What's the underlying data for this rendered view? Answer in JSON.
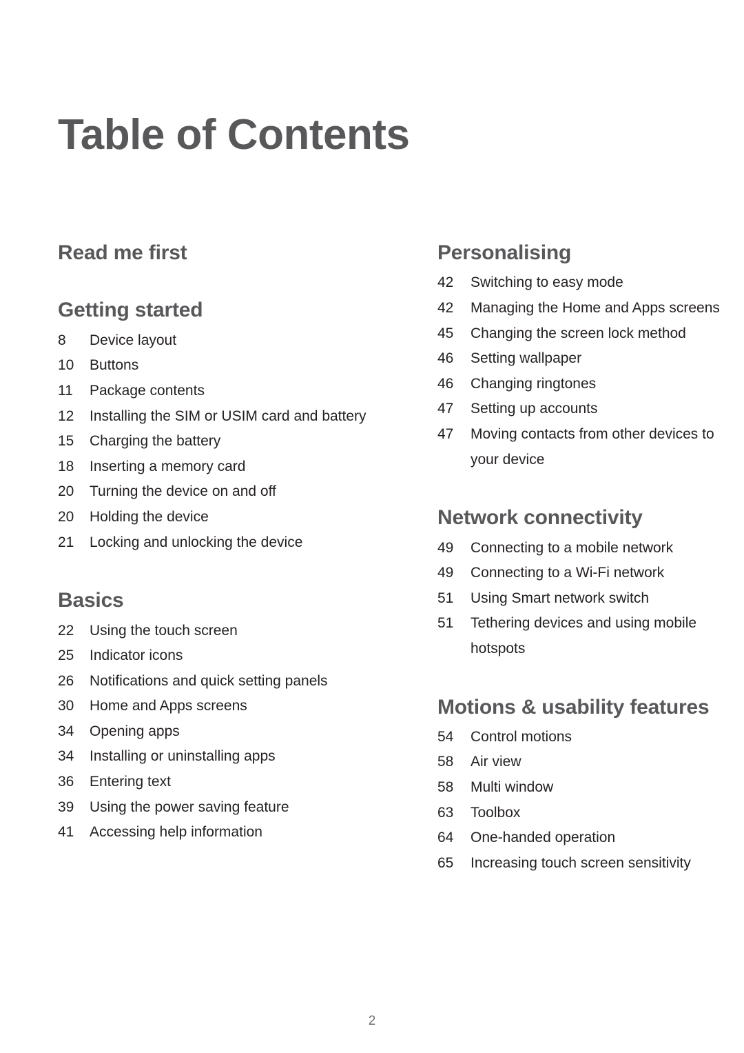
{
  "document": {
    "title": "Table of Contents",
    "folio": "2"
  },
  "columns": {
    "left": [
      {
        "heading": "Read me first",
        "entries": []
      },
      {
        "heading": "Getting started",
        "entries": [
          {
            "page": "8",
            "title": "Device layout"
          },
          {
            "page": "10",
            "title": "Buttons"
          },
          {
            "page": "11",
            "title": "Package contents"
          },
          {
            "page": "12",
            "title": "Installing the SIM or USIM card and battery"
          },
          {
            "page": "15",
            "title": "Charging the battery"
          },
          {
            "page": "18",
            "title": "Inserting a memory card"
          },
          {
            "page": "20",
            "title": "Turning the device on and off"
          },
          {
            "page": "20",
            "title": "Holding the device"
          },
          {
            "page": "21",
            "title": "Locking and unlocking the device"
          }
        ]
      },
      {
        "heading": "Basics",
        "entries": [
          {
            "page": "22",
            "title": "Using the touch screen"
          },
          {
            "page": "25",
            "title": "Indicator icons"
          },
          {
            "page": "26",
            "title": "Notifications and quick setting panels"
          },
          {
            "page": "30",
            "title": "Home and Apps screens"
          },
          {
            "page": "34",
            "title": "Opening apps"
          },
          {
            "page": "34",
            "title": "Installing or uninstalling apps"
          },
          {
            "page": "36",
            "title": "Entering text"
          },
          {
            "page": "39",
            "title": "Using the power saving feature"
          },
          {
            "page": "41",
            "title": "Accessing help information"
          }
        ]
      }
    ],
    "right": [
      {
        "heading": "Personalising",
        "entries": [
          {
            "page": "42",
            "title": "Switching to easy mode"
          },
          {
            "page": "42",
            "title": "Managing the Home and Apps screens"
          },
          {
            "page": "45",
            "title": "Changing the screen lock method"
          },
          {
            "page": "46",
            "title": "Setting wallpaper"
          },
          {
            "page": "46",
            "title": "Changing ringtones"
          },
          {
            "page": "47",
            "title": "Setting up accounts"
          },
          {
            "page": "47",
            "title": "Moving contacts from other devices to your device"
          }
        ]
      },
      {
        "heading": "Network connectivity",
        "entries": [
          {
            "page": "49",
            "title": "Connecting to a mobile network"
          },
          {
            "page": "49",
            "title": "Connecting to a Wi-Fi network"
          },
          {
            "page": "51",
            "title": "Using Smart network switch"
          },
          {
            "page": "51",
            "title": "Tethering devices and using mobile hotspots"
          }
        ]
      },
      {
        "heading": "Motions & usability features",
        "entries": [
          {
            "page": "54",
            "title": "Control motions"
          },
          {
            "page": "58",
            "title": "Air view"
          },
          {
            "page": "58",
            "title": "Multi window"
          },
          {
            "page": "63",
            "title": "Toolbox"
          },
          {
            "page": "64",
            "title": "One-handed operation"
          },
          {
            "page": "65",
            "title": "Increasing touch screen sensitivity"
          }
        ]
      }
    ]
  },
  "colors": {
    "heading": "#58585B",
    "body": "#231F20",
    "folio": "#6D6E71",
    "background": "#FFFFFF"
  }
}
